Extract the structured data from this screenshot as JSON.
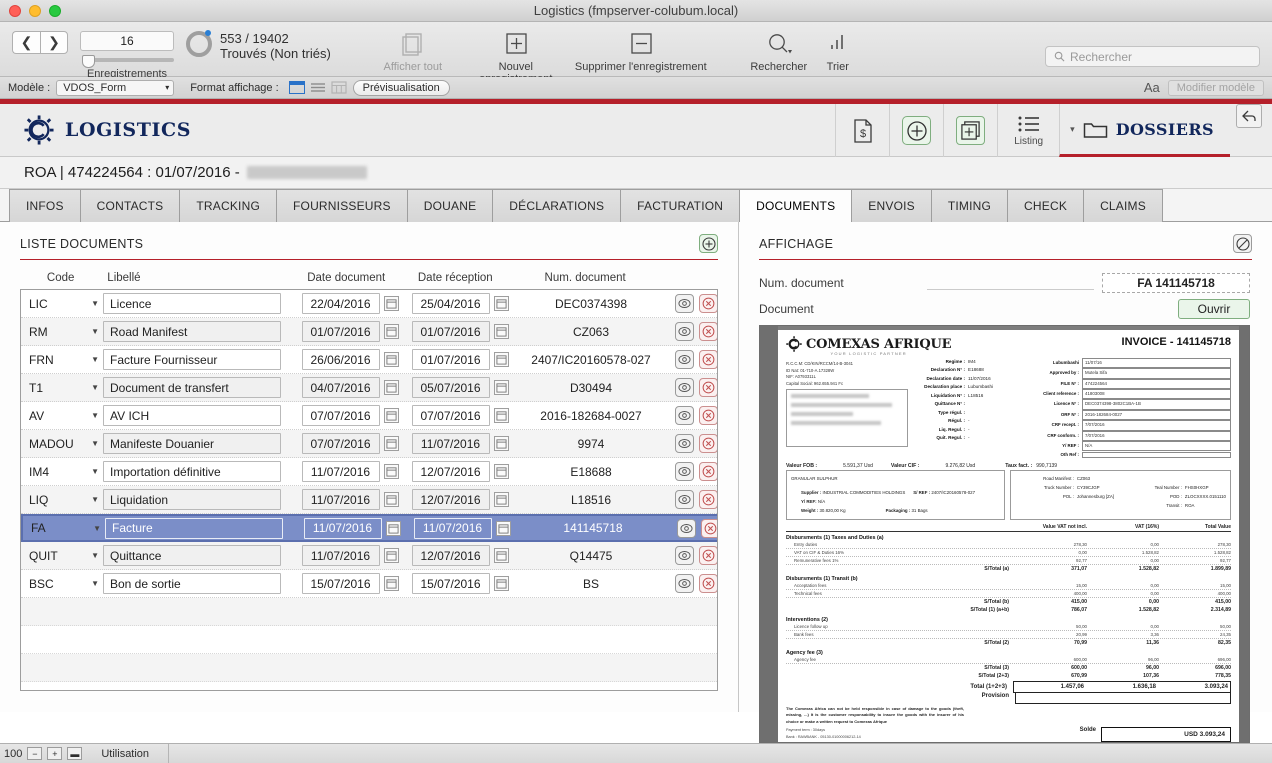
{
  "window": {
    "title": "Logistics (fmpserver-colubum.local)"
  },
  "toolbar": {
    "record_number": "16",
    "found_count": "553 / 19402",
    "found_status": "Trouvés (Non triés)",
    "records_label": "Enregistrements",
    "show_all_label": "Afficher tout",
    "new_record_label": "Nouvel enregistrement",
    "delete_record_label": "Supprimer l'enregistrement",
    "find_label": "Rechercher",
    "sort_label": "Trier",
    "search_placeholder": "Rechercher",
    "prev_icon": "chevron-left-icon",
    "next_icon": "chevron-right-icon"
  },
  "layout_bar": {
    "model_label": "Modèle :",
    "model_value": "VDOS_Form",
    "view_label": "Format affichage :",
    "preview_label": "Prévisualisation",
    "text_format_icon": "Aa",
    "edit_layout_label": "Modifier modèle"
  },
  "app_header": {
    "brand": "LOGISTICS",
    "brand_icon": "gear-logo-icon",
    "section_label": "DOSSIERS",
    "tools": [
      {
        "name": "invoice-dollar-icon",
        "label": ""
      },
      {
        "name": "add-circle-icon",
        "label": ""
      },
      {
        "name": "duplicate-add-icon",
        "label": ""
      },
      {
        "name": "list-icon",
        "label": "Listing"
      }
    ],
    "back_icon": "back-arrow-icon"
  },
  "record": {
    "title_prefix": "ROA | 474224564 : 01/07/2016 -"
  },
  "tabs": [
    {
      "label": "INFOS",
      "active": false
    },
    {
      "label": "CONTACTS",
      "active": false
    },
    {
      "label": "TRACKING",
      "active": false
    },
    {
      "label": "FOURNISSEURS",
      "active": false
    },
    {
      "label": "DOUANE",
      "active": false
    },
    {
      "label": "DÉCLARATIONS",
      "active": false
    },
    {
      "label": "FACTURATION",
      "active": false
    },
    {
      "label": "DOCUMENTS",
      "active": true
    },
    {
      "label": "ENVOIS",
      "active": false
    },
    {
      "label": "TIMING",
      "active": false
    },
    {
      "label": "CHECK",
      "active": false
    },
    {
      "label": "CLAIMS",
      "active": false
    }
  ],
  "documents_panel": {
    "title": "LISTE DOCUMENTS",
    "add_icon": "add-circle-icon",
    "columns": [
      "Code",
      "Libellé",
      "Date document",
      "Date réception",
      "Num. document"
    ],
    "rows": [
      {
        "code": "LIC",
        "libelle": "Licence",
        "date_doc": "22/04/2016",
        "date_rec": "25/04/2016",
        "num": "DEC0374398"
      },
      {
        "code": "RM",
        "libelle": "Road Manifest",
        "date_doc": "01/07/2016",
        "date_rec": "01/07/2016",
        "num": "CZ063"
      },
      {
        "code": "FRN",
        "libelle": "Facture Fournisseur",
        "date_doc": "26/06/2016",
        "date_rec": "01/07/2016",
        "num": "2407/IC20160578-027"
      },
      {
        "code": "T1",
        "libelle": "Document de transfert",
        "date_doc": "04/07/2016",
        "date_rec": "05/07/2016",
        "num": "D30494"
      },
      {
        "code": "AV",
        "libelle": "AV ICH",
        "date_doc": "07/07/2016",
        "date_rec": "07/07/2016",
        "num": "2016-182684-0027"
      },
      {
        "code": "MADOU",
        "libelle": "Manifeste Douanier",
        "date_doc": "07/07/2016",
        "date_rec": "11/07/2016",
        "num": "9974"
      },
      {
        "code": "IM4",
        "libelle": "Importation définitive",
        "date_doc": "11/07/2016",
        "date_rec": "12/07/2016",
        "num": "E18688"
      },
      {
        "code": "LIQ",
        "libelle": "Liquidation",
        "date_doc": "11/07/2016",
        "date_rec": "12/07/2016",
        "num": "L18516"
      },
      {
        "code": "FA",
        "libelle": "Facture",
        "date_doc": "11/07/2016",
        "date_rec": "11/07/2016",
        "num": "141145718",
        "selected": true
      },
      {
        "code": "QUIT",
        "libelle": "Quittance",
        "date_doc": "11/07/2016",
        "date_rec": "12/07/2016",
        "num": "Q14475"
      },
      {
        "code": "BSC",
        "libelle": "Bon de sortie",
        "date_doc": "15/07/2016",
        "date_rec": "15/07/2016",
        "num": "BS"
      }
    ]
  },
  "display_panel": {
    "title": "AFFICHAGE",
    "clear_icon": "no-entry-icon",
    "num_label": "Num. document",
    "num_value": "FA 141145718",
    "document_label": "Document",
    "open_button": "Ouvrir"
  },
  "invoice": {
    "company": "COMEXAS AFRIQUE",
    "tagline": "YOUR LOGISTIC PARTNER",
    "title": "INVOICE - 141145718",
    "legal": [
      "R.C.C.M: CD/KIN/RCCM/14-B-3041",
      "ID Nat: 01-710-A.17328W",
      "NIF: A0793311L",
      "Capital Social: 962.655.941 Fc"
    ],
    "declaration": [
      {
        "k": "Regime :",
        "v": "IM4"
      },
      {
        "k": "Declaration N° :",
        "v": "E18688"
      },
      {
        "k": "Declaration date :",
        "v": "11/07/2016"
      },
      {
        "k": "Declaration place :",
        "v": "Lubumbashi"
      },
      {
        "k": "Liquidation N° :",
        "v": "L18516"
      },
      {
        "k": "Quittance N° :",
        "v": ""
      },
      {
        "k": "Type régul. :",
        "v": ""
      },
      {
        "k": "Régul. :",
        "v": "-"
      },
      {
        "k": "Liq. Regul. :",
        "v": "-"
      },
      {
        "k": "Quit. Regul. :",
        "v": "-"
      }
    ],
    "refs": [
      {
        "k": "Lubumbashi",
        "v": "11/07/16"
      },
      {
        "k": "Approved by :",
        "v": "Mutela Sifa"
      },
      {
        "k": "FILE N° :",
        "v": "474224564"
      },
      {
        "k": "Client reference :",
        "v": "41803008"
      },
      {
        "k": "Licence N° :",
        "v": "DEC0374398-3802C1BA-1B"
      },
      {
        "k": "ORF N° :",
        "v": "2016-182684-0027"
      },
      {
        "k": "CRF recept. :",
        "v": "7/07/2016"
      },
      {
        "k": "CRF conform. :",
        "v": "7/07/2016"
      },
      {
        "k": "Y/ REF :",
        "v": "N/A"
      },
      {
        "k": "Oth Ref :",
        "v": ""
      }
    ],
    "valeur_fob_label": "Valeur FOB :",
    "valeur_fob": "5.591,37 Usd",
    "valeur_cif_label": "Valeur CIF :",
    "valeur_cif": "9.276,82 Usd",
    "taux_label": "Taux fact. :",
    "taux": "990,7139",
    "goods": {
      "description": "GRANULAR SULPHUR",
      "supplier_label": "Supplier :",
      "supplier": "INDUSTRIAL COMMODITIES HOLDINGS",
      "sref_label": "S/ REF :",
      "sref": "2407/IC20160578-027",
      "yref_label": "Y/ REF:",
      "yref": "N/A",
      "weight_label": "Weight :",
      "weight": "30.820,00  Kg",
      "packaging_label": "Packaging :",
      "packaging": "31 Bags"
    },
    "transport": [
      {
        "k": "Road Manifest :",
        "v": "CZ063"
      },
      {
        "k": "Truck Number :",
        "v": "CY39CJGP"
      },
      {
        "k": "POL :",
        "v": "Johannesburg [ZA]"
      },
      {
        "k": "Teal Number :",
        "v": "FHS0HXGP"
      },
      {
        "k": "POD :",
        "v": "ZLOCXXXX.0151110"
      },
      {
        "k": "Transit :",
        "v": "ROA"
      }
    ],
    "col_headers": [
      "Value VAT not incl.",
      "VAT (16%)",
      "Total Value"
    ],
    "sections": [
      {
        "label": "Disbursments (1)  Taxes and Duties (a)",
        "items": [
          {
            "name": "Entry duties",
            "v1": "278,30",
            "v2": "0,00",
            "v3": "278,30"
          },
          {
            "name": "VAT on CIF & Duties 16%",
            "v1": "0,00",
            "v2": "1.528,82",
            "v3": "1.528,82"
          },
          {
            "name": "Remunerative fees 1%",
            "v1": "92,77",
            "v2": "0,00",
            "v3": "92,77"
          }
        ],
        "subtotal": {
          "label": "S/Total (a)",
          "v1": "371,07",
          "v2": "1.528,82",
          "v3": "1.899,89"
        }
      },
      {
        "label": "Disbursments (1)  Transit (b)",
        "items": [
          {
            "name": "Acceptation fees",
            "v1": "15,00",
            "v2": "0,00",
            "v3": "15,00"
          },
          {
            "name": "Technical fees",
            "v1": "400,00",
            "v2": "0,00",
            "v3": "400,00"
          }
        ],
        "subtotal": {
          "label": "S/Total (b)",
          "v1": "415,00",
          "v2": "0,00",
          "v3": "415,00"
        },
        "subtotal2": {
          "label": "S/Total  (1) (a+b)",
          "v1": "786,07",
          "v2": "1.528,82",
          "v3": "2.314,89"
        }
      },
      {
        "label": "Interventions (2)",
        "items": [
          {
            "name": "Licence follow up",
            "v1": "50,00",
            "v2": "0,00",
            "v3": "50,00"
          },
          {
            "name": "Bank fees",
            "v1": "20,99",
            "v2": "3,36",
            "v3": "24,35"
          }
        ],
        "subtotal": {
          "label": "S/Total (2)",
          "v1": "70,99",
          "v2": "11,36",
          "v3": "82,35"
        }
      },
      {
        "label": "Agency fee (3)",
        "items": [
          {
            "name": "Agency fee",
            "v1": "600,00",
            "v2": "96,00",
            "v3": "696,00"
          }
        ],
        "subtotal": {
          "label": "S/Total (3)",
          "v1": "600,00",
          "v2": "96,00",
          "v3": "696,00"
        },
        "subtotal2": {
          "label": "S/Total  (2+3)",
          "v1": "670,99",
          "v2": "107,36",
          "v3": "778,35"
        }
      }
    ],
    "grand_total": {
      "label": "Total (1+2+3)",
      "v1": "1.457,06",
      "v2": "1.636,18",
      "v3": "3.093,24"
    },
    "provision_label": "Provision",
    "disclaimer": "The Comexas Africa can not be held responsible in case of damage to the goods (theft, missing, ...) It is the customer responsability to insure the goods with the insurer of his choice or make a written request to Comexas Afrique",
    "payment_term": "Payment term : 30days",
    "bank": "Bank : RAWBANK - 05130-01000006212-14",
    "solde_label": "Solde",
    "solde_value": "USD 3.093,24"
  },
  "statusbar": {
    "zoom": "100",
    "usage_label": "Utilisation"
  },
  "colors": {
    "accent_red": "#b5202a",
    "brand_navy": "#12275c",
    "selection_blue": "#7b8ec8"
  }
}
